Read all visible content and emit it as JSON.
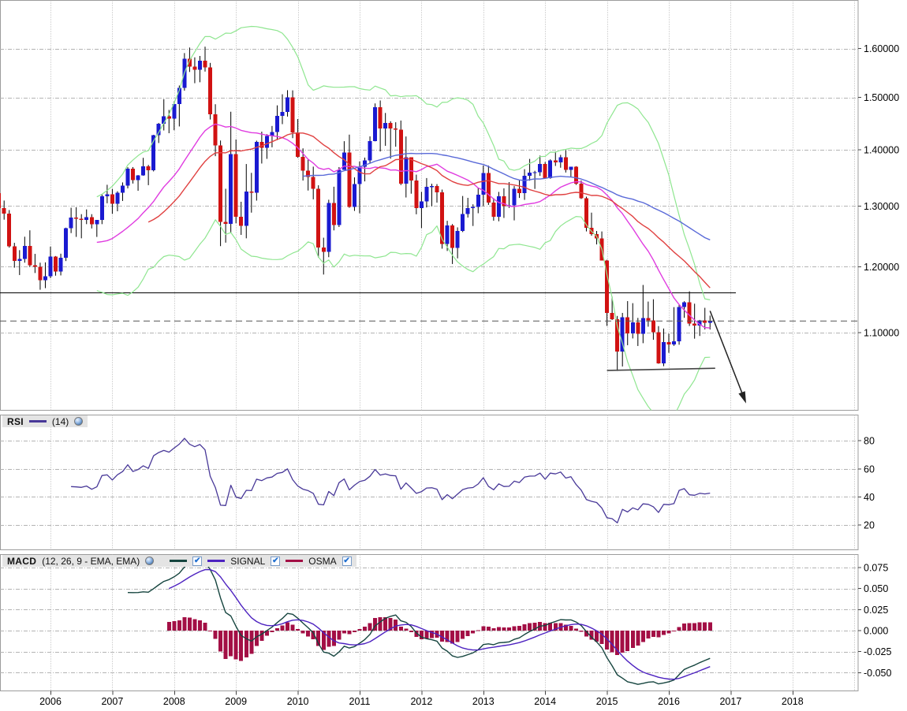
{
  "legends": {
    "rsi": {
      "title": "RSI",
      "param": "(14)"
    },
    "macd": {
      "title": "MACD",
      "param": "(12, 26, 9 - EMA, EMA)",
      "series": [
        {
          "label": "",
          "checked": "✔"
        },
        {
          "label": "SIGNAL",
          "checked": "✔"
        },
        {
          "label": "OSMA",
          "checked": "✔"
        }
      ]
    }
  },
  "chart_data": {
    "type": "candlestick",
    "interval": "monthly",
    "price_axis": {
      "scale": "logarithmic",
      "tick_labels": [
        "1.60000",
        "1.50000",
        "1.40000",
        "1.30000",
        "1.20000",
        "1.10000"
      ],
      "tick_values": [
        1.6,
        1.5,
        1.4,
        1.3,
        1.2,
        1.1
      ]
    },
    "x_axis": {
      "tick_labels": [
        "2006",
        "2007",
        "2008",
        "2009",
        "2010",
        "2011",
        "2012",
        "2013",
        "2014",
        "2015",
        "2016",
        "2017",
        "2018"
      ]
    },
    "rsi_axis": {
      "tick_labels": [
        "80",
        "60",
        "40",
        "20"
      ],
      "tick_values": [
        80,
        60,
        40,
        20
      ]
    },
    "macd_axis": {
      "tick_labels": [
        "0.075",
        "0.050",
        "0.025",
        "0.000",
        "-0.025",
        "-0.050"
      ],
      "tick_values": [
        0.075,
        0.05,
        0.025,
        0.0,
        -0.025,
        -0.05
      ]
    },
    "candles": {
      "start_month": "2005-03",
      "ohlc": [
        [
          1.322,
          1.348,
          1.287,
          1.2964
        ],
        [
          1.2964,
          1.3093,
          1.2767,
          1.2868
        ],
        [
          1.2868,
          1.293,
          1.2305,
          1.2329
        ],
        [
          1.2329,
          1.2383,
          1.1984,
          1.2092
        ],
        [
          1.2092,
          1.2264,
          1.1868,
          1.2124
        ],
        [
          1.2124,
          1.2483,
          1.2063,
          1.233
        ],
        [
          1.233,
          1.2589,
          1.1996,
          1.2024
        ],
        [
          1.2024,
          1.2204,
          1.19,
          1.1995
        ],
        [
          1.1995,
          1.2063,
          1.164,
          1.179
        ],
        [
          1.179,
          1.2068,
          1.1665,
          1.1849
        ],
        [
          1.1849,
          1.2322,
          1.1821,
          1.2158
        ],
        [
          1.2158,
          1.2169,
          1.1858,
          1.1925
        ],
        [
          1.1925,
          1.2207,
          1.1862,
          1.2139
        ],
        [
          1.2139,
          1.2633,
          1.2089,
          1.2627
        ],
        [
          1.2627,
          1.297,
          1.2543,
          1.28
        ],
        [
          1.28,
          1.2979,
          1.248,
          1.2784
        ],
        [
          1.2784,
          1.286,
          1.2457,
          1.2764
        ],
        [
          1.2764,
          1.2941,
          1.2692,
          1.2811
        ],
        [
          1.2811,
          1.286,
          1.262,
          1.269
        ],
        [
          1.269,
          1.276,
          1.248,
          1.2766
        ],
        [
          1.2766,
          1.3197,
          1.2692,
          1.317
        ],
        [
          1.317,
          1.3368,
          1.3046,
          1.3198
        ],
        [
          1.3198,
          1.3296,
          1.2865,
          1.3035
        ],
        [
          1.3035,
          1.3254,
          1.2909,
          1.323
        ],
        [
          1.323,
          1.341,
          1.3086,
          1.3354
        ],
        [
          1.3354,
          1.3682,
          1.3305,
          1.3652
        ],
        [
          1.3652,
          1.3684,
          1.339,
          1.3453
        ],
        [
          1.3453,
          1.354,
          1.3263,
          1.3537
        ],
        [
          1.3537,
          1.3852,
          1.3528,
          1.37
        ],
        [
          1.37,
          1.3723,
          1.3361,
          1.3629
        ],
        [
          1.3629,
          1.4278,
          1.3606,
          1.4271
        ],
        [
          1.4271,
          1.4504,
          1.4125,
          1.4486
        ],
        [
          1.4486,
          1.4966,
          1.4361,
          1.4632
        ],
        [
          1.4632,
          1.4755,
          1.4309,
          1.4588
        ],
        [
          1.4588,
          1.4922,
          1.4365,
          1.487
        ],
        [
          1.487,
          1.5238,
          1.4437,
          1.5187
        ],
        [
          1.5187,
          1.5903,
          1.5135,
          1.5785
        ],
        [
          1.5785,
          1.602,
          1.5512,
          1.5622
        ],
        [
          1.5622,
          1.5814,
          1.5284,
          1.5554
        ],
        [
          1.5554,
          1.5843,
          1.5303,
          1.5747
        ],
        [
          1.5747,
          1.6038,
          1.552,
          1.5602
        ],
        [
          1.5602,
          1.5699,
          1.457,
          1.4673
        ],
        [
          1.4673,
          1.4866,
          1.3882,
          1.4081
        ],
        [
          1.4081,
          1.4171,
          1.2329,
          1.2727
        ],
        [
          1.2727,
          1.3298,
          1.2386,
          1.2694
        ],
        [
          1.2694,
          1.4719,
          1.255,
          1.3917
        ],
        [
          1.3917,
          1.4191,
          1.2706,
          1.2816
        ],
        [
          1.2816,
          1.3072,
          1.2513,
          1.2662
        ],
        [
          1.2662,
          1.3739,
          1.2457,
          1.3252
        ],
        [
          1.3252,
          1.358,
          1.2886,
          1.3229
        ],
        [
          1.3229,
          1.4169,
          1.3092,
          1.4144
        ],
        [
          1.4144,
          1.4338,
          1.3748,
          1.4033
        ],
        [
          1.4033,
          1.4291,
          1.3833,
          1.4255
        ],
        [
          1.4255,
          1.4446,
          1.4045,
          1.4332
        ],
        [
          1.4332,
          1.4844,
          1.4179,
          1.4636
        ],
        [
          1.4636,
          1.5063,
          1.4481,
          1.4715
        ],
        [
          1.4715,
          1.5144,
          1.4626,
          1.5005
        ],
        [
          1.5005,
          1.5141,
          1.4216,
          1.4326
        ],
        [
          1.4326,
          1.4579,
          1.3852,
          1.3866
        ],
        [
          1.3866,
          1.4026,
          1.3443,
          1.3622
        ],
        [
          1.3622,
          1.3818,
          1.3267,
          1.351
        ],
        [
          1.351,
          1.3692,
          1.3114,
          1.3295
        ],
        [
          1.3295,
          1.3359,
          1.2144,
          1.2306
        ],
        [
          1.2306,
          1.2467,
          1.1876,
          1.2238
        ],
        [
          1.2238,
          1.3107,
          1.2151,
          1.3049
        ],
        [
          1.3049,
          1.3334,
          1.2588,
          1.268
        ],
        [
          1.268,
          1.3684,
          1.2644,
          1.3634
        ],
        [
          1.3634,
          1.4159,
          1.3634,
          1.3947
        ],
        [
          1.3947,
          1.4282,
          1.2969,
          1.2983
        ],
        [
          1.2983,
          1.3499,
          1.2915,
          1.3379
        ],
        [
          1.3379,
          1.3786,
          1.2875,
          1.3692
        ],
        [
          1.3692,
          1.3856,
          1.3428,
          1.3806
        ],
        [
          1.3806,
          1.4249,
          1.3752,
          1.4158
        ],
        [
          1.4158,
          1.4882,
          1.4156,
          1.4807
        ],
        [
          1.4807,
          1.494,
          1.3968,
          1.4396
        ],
        [
          1.4396,
          1.4696,
          1.4073,
          1.4502
        ],
        [
          1.4502,
          1.4536,
          1.3837,
          1.4397
        ],
        [
          1.4397,
          1.4517,
          1.4056,
          1.4378
        ],
        [
          1.4378,
          1.455,
          1.3363,
          1.3387
        ],
        [
          1.3387,
          1.4247,
          1.3146,
          1.386
        ],
        [
          1.386,
          1.386,
          1.3212,
          1.3446
        ],
        [
          1.3446,
          1.3548,
          1.2858,
          1.2961
        ],
        [
          1.2961,
          1.3245,
          1.2624,
          1.3081
        ],
        [
          1.3081,
          1.3487,
          1.2974,
          1.3329
        ],
        [
          1.3329,
          1.3386,
          1.2994,
          1.3343
        ],
        [
          1.3343,
          1.338,
          1.3057,
          1.3239
        ],
        [
          1.3239,
          1.3284,
          1.2288,
          1.2364
        ],
        [
          1.2364,
          1.2748,
          1.2251,
          1.2668
        ],
        [
          1.2668,
          1.2693,
          1.2042,
          1.2302
        ],
        [
          1.2302,
          1.2638,
          1.2132,
          1.2578
        ],
        [
          1.2578,
          1.3172,
          1.256,
          1.286
        ],
        [
          1.286,
          1.314,
          1.2803,
          1.296
        ],
        [
          1.296,
          1.3028,
          1.2661,
          1.2985
        ],
        [
          1.2985,
          1.3308,
          1.2876,
          1.3194
        ],
        [
          1.3194,
          1.3711,
          1.2998,
          1.3579
        ],
        [
          1.3579,
          1.3711,
          1.3018,
          1.3055
        ],
        [
          1.3055,
          1.3135,
          1.275,
          1.2819
        ],
        [
          1.2819,
          1.3243,
          1.274,
          1.3168
        ],
        [
          1.3168,
          1.3306,
          1.2796,
          1.2998
        ],
        [
          1.2998,
          1.3415,
          1.2967,
          1.301
        ],
        [
          1.301,
          1.3345,
          1.2755,
          1.33
        ],
        [
          1.33,
          1.3452,
          1.3138,
          1.3222
        ],
        [
          1.3222,
          1.3646,
          1.3105,
          1.3527
        ],
        [
          1.3527,
          1.3832,
          1.3441,
          1.3583
        ],
        [
          1.3583,
          1.3617,
          1.3295,
          1.3591
        ],
        [
          1.3591,
          1.3893,
          1.3525,
          1.3743
        ],
        [
          1.3743,
          1.3775,
          1.3477,
          1.3486
        ],
        [
          1.3486,
          1.3824,
          1.3475,
          1.3802
        ],
        [
          1.3802,
          1.3967,
          1.3704,
          1.3771
        ],
        [
          1.3771,
          1.3906,
          1.3672,
          1.3865
        ],
        [
          1.3865,
          1.3993,
          1.3586,
          1.3634
        ],
        [
          1.3634,
          1.3677,
          1.3502,
          1.3692
        ],
        [
          1.3692,
          1.37,
          1.3366,
          1.3388
        ],
        [
          1.3388,
          1.3445,
          1.312,
          1.3132
        ],
        [
          1.3132,
          1.316,
          1.2571,
          1.2631
        ],
        [
          1.2631,
          1.2886,
          1.25,
          1.2524
        ],
        [
          1.2524,
          1.2578,
          1.2357,
          1.2453
        ],
        [
          1.2453,
          1.257,
          1.2097,
          1.2098
        ],
        [
          1.2098,
          1.2109,
          1.1098,
          1.1288
        ],
        [
          1.1288,
          1.1534,
          1.1185,
          1.1197
        ],
        [
          1.1197,
          1.1245,
          1.0458,
          1.0731
        ],
        [
          1.0731,
          1.129,
          1.052,
          1.1224
        ],
        [
          1.1224,
          1.1467,
          1.0819,
          1.0986
        ],
        [
          1.0986,
          1.1436,
          1.0916,
          1.1147
        ],
        [
          1.1147,
          1.1216,
          1.0808,
          1.0984
        ],
        [
          1.0984,
          1.1714,
          1.0848,
          1.1211
        ],
        [
          1.1211,
          1.146,
          1.1087,
          1.1177
        ],
        [
          1.1177,
          1.1495,
          1.0897,
          1.1006
        ],
        [
          1.1006,
          1.1095,
          1.0558,
          1.0565
        ],
        [
          1.0565,
          1.106,
          1.0524,
          1.0862
        ],
        [
          1.0862,
          1.0985,
          1.0711,
          1.0832
        ],
        [
          1.0832,
          1.1376,
          1.081,
          1.0873
        ],
        [
          1.0873,
          1.1412,
          1.0826,
          1.138
        ],
        [
          1.138,
          1.1465,
          1.1217,
          1.1451
        ],
        [
          1.1451,
          1.1616,
          1.1097,
          1.1131
        ],
        [
          1.1131,
          1.1428,
          1.0913,
          1.1102
        ],
        [
          1.1102,
          1.1186,
          1.0952,
          1.1176
        ],
        [
          1.1176,
          1.1366,
          1.1046,
          1.1146
        ],
        [
          1.1146,
          1.125,
          1.1046,
          1.117
        ]
      ]
    },
    "overlays": {
      "bollinger": {
        "period": 20,
        "deviation": 2
      },
      "ma_fast": {
        "period": 20
      },
      "ma_mid": {
        "period": 30
      },
      "ma_slow": {
        "period": 60
      }
    },
    "indicators": {
      "rsi": {
        "period": 14
      },
      "macd": {
        "fast": 12,
        "slow": 26,
        "signal": 9
      }
    },
    "annotations": {
      "horizontal_line": {
        "price": 1.16,
        "end_month": "2017-02"
      },
      "last_price_dashed_line": {
        "price": 1.117
      },
      "support_trendline": {
        "start": {
          "month": "2015-01",
          "price": 1.0465
        },
        "end": {
          "month": "2016-10",
          "price": 1.0495
        }
      },
      "arrow": {
        "from": {
          "month": "2016-09",
          "price": 1.132
        },
        "to": {
          "month": "2017-04",
          "price": 1.002
        }
      }
    },
    "colors": {
      "candle_up": "#1a1ad1",
      "candle_down": "#d11212",
      "wick": "#000000",
      "bollinger": "#8fe690",
      "ma_fast": "#e03ce0",
      "ma_mid": "#e04040",
      "ma_slow": "#5a6ad8",
      "rsi": "#483898",
      "macd": "#16453f",
      "signal": "#4d22c0",
      "osma": "#a30f45",
      "grid": "#b3b3b3",
      "panel_border": "#9c9c9c",
      "axis_text": "#000000",
      "annotation": "#222222",
      "dashed_line": "#555555"
    }
  }
}
